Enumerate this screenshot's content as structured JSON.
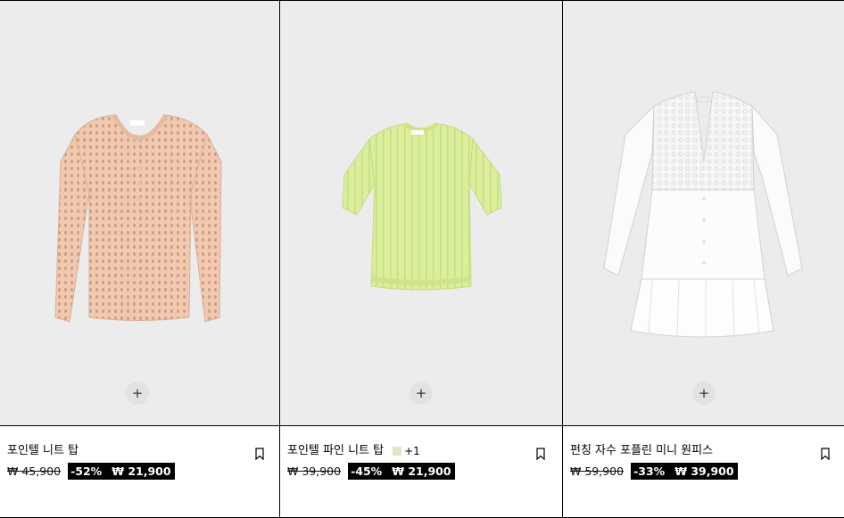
{
  "products": [
    {
      "name": "포인텔 니트 탑",
      "original_price": "₩ 45,900",
      "discount": "-52%",
      "sale_price": "₩ 21,900",
      "image_icon": "peach-knit-long-sleeve-top",
      "garment_color": "#f1c7ad",
      "add_icon": "+",
      "bookmark_icon": "bookmark-icon"
    },
    {
      "name": "포인텔 파인 니트 탑",
      "swatch_color": "#dfe6c4",
      "more_colors": "+1",
      "original_price": "₩ 39,900",
      "discount": "-45%",
      "sale_price": "₩ 21,900",
      "image_icon": "lime-knit-short-sleeve-top",
      "garment_color": "#d9ee98",
      "add_icon": "+",
      "bookmark_icon": "bookmark-icon"
    },
    {
      "name": "펀칭 자수 포플린 미니 원피스",
      "original_price": "₩ 59,900",
      "discount": "-33%",
      "sale_price": "₩ 39,900",
      "image_icon": "white-poplin-mini-dress",
      "garment_color": "#ffffff",
      "add_icon": "+",
      "bookmark_icon": "bookmark-icon"
    }
  ]
}
